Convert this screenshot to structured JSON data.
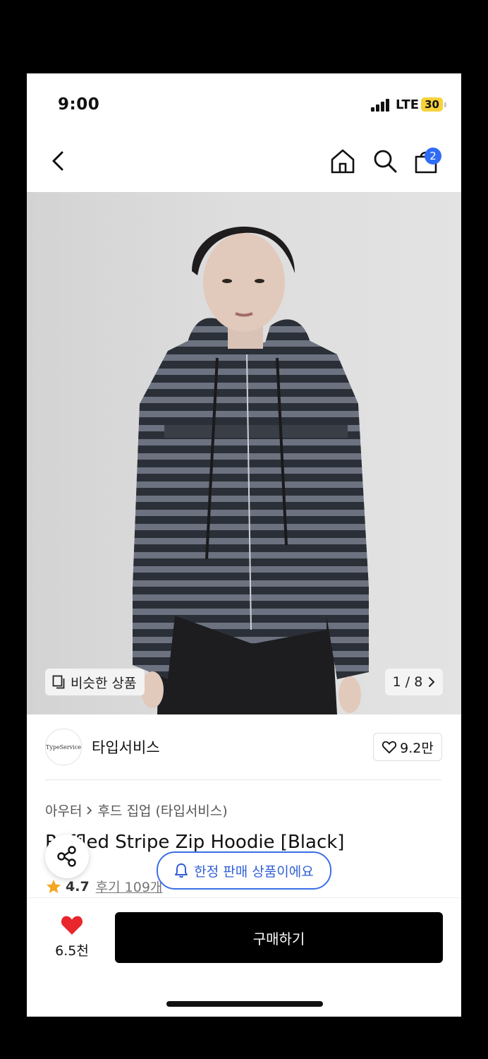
{
  "status_bar": {
    "time": "9:00",
    "network": "LTE",
    "battery": "30"
  },
  "nav": {
    "cart_count": "2"
  },
  "gallery": {
    "similar_label": "비슷한 상품",
    "page_indicator": "1 / 8"
  },
  "brand": {
    "logo_text": "TypeService",
    "name": "타입서비스",
    "likes": "9.2만"
  },
  "product": {
    "breadcrumb": [
      "아우터",
      "후드 집업 (타입서비스)"
    ],
    "title": "Ruffled Stripe Zip Hoodie [Black]",
    "rating": "4.7",
    "reviews": "후기 109개"
  },
  "toast": {
    "limited_label": "한정 판매 상품이에요"
  },
  "bottom_bar": {
    "wish_count": "6.5천",
    "buy_label": "구매하기"
  },
  "colors": {
    "accent_blue": "#2f6cf6",
    "heart_red": "#e8262c",
    "star": "#f5a623"
  }
}
